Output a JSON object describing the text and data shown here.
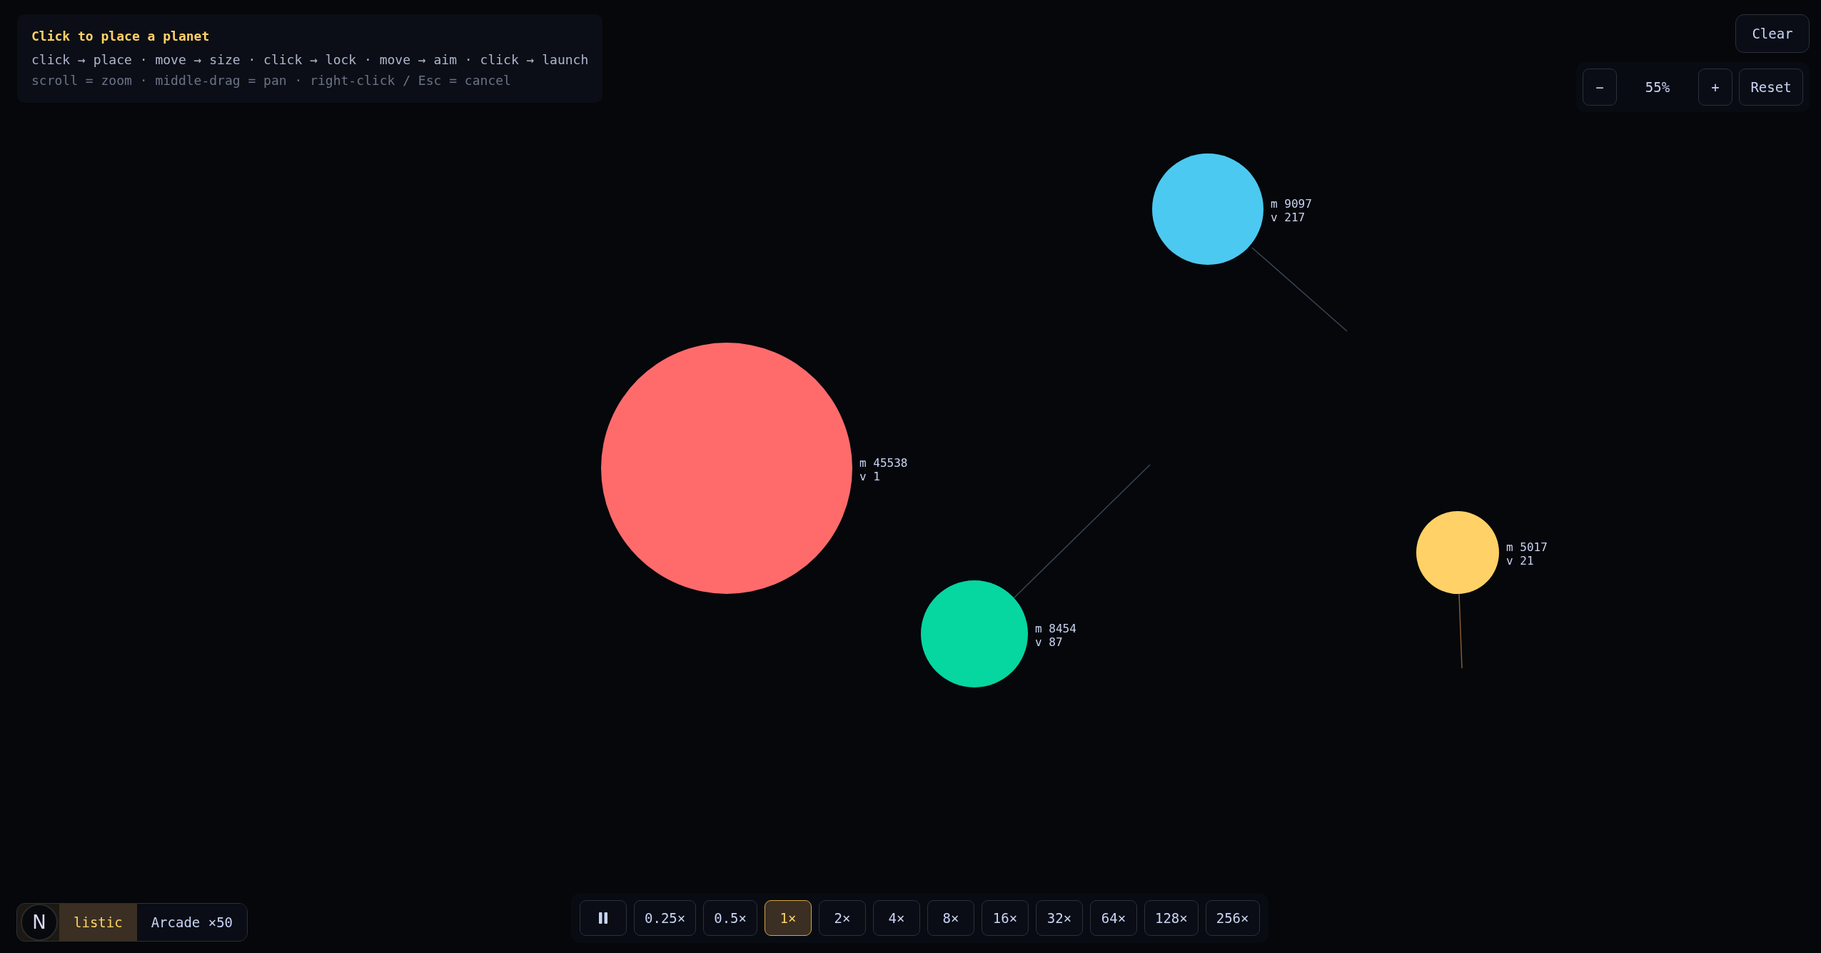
{
  "help": {
    "title": "Click to place a planet",
    "steps": "click → place · move → size · click → lock · move → aim · click → launch",
    "hints": "scroll = zoom · middle-drag = pan · right-click / Esc = cancel"
  },
  "clear_button": "Clear",
  "zoom": {
    "out": "−",
    "value": "55%",
    "in": "+",
    "reset": "Reset"
  },
  "planets": [
    {
      "color": "#ff6b6b",
      "mass": "m 45538",
      "velocity": "v 1"
    },
    {
      "color": "#4cc9f0",
      "mass": "m 9097",
      "velocity": "v 217"
    },
    {
      "color": "#06d6a0",
      "mass": "m 8454",
      "velocity": "v 87"
    },
    {
      "color": "#ffd166",
      "mass": "m 5017",
      "velocity": "v 21"
    }
  ],
  "mode_toggle": [
    {
      "label": "listic",
      "selected": true
    },
    {
      "label": "Arcade ×50",
      "selected": false
    }
  ],
  "badge": "N",
  "speed_bar": {
    "paused": false,
    "speeds": [
      {
        "label": "0.25×",
        "selected": false
      },
      {
        "label": "0.5×",
        "selected": false
      },
      {
        "label": "1×",
        "selected": true
      },
      {
        "label": "2×",
        "selected": false
      },
      {
        "label": "4×",
        "selected": false
      },
      {
        "label": "8×",
        "selected": false
      },
      {
        "label": "16×",
        "selected": false
      },
      {
        "label": "32×",
        "selected": false
      },
      {
        "label": "64×",
        "selected": false
      },
      {
        "label": "128×",
        "selected": false
      },
      {
        "label": "256×",
        "selected": false
      }
    ]
  }
}
